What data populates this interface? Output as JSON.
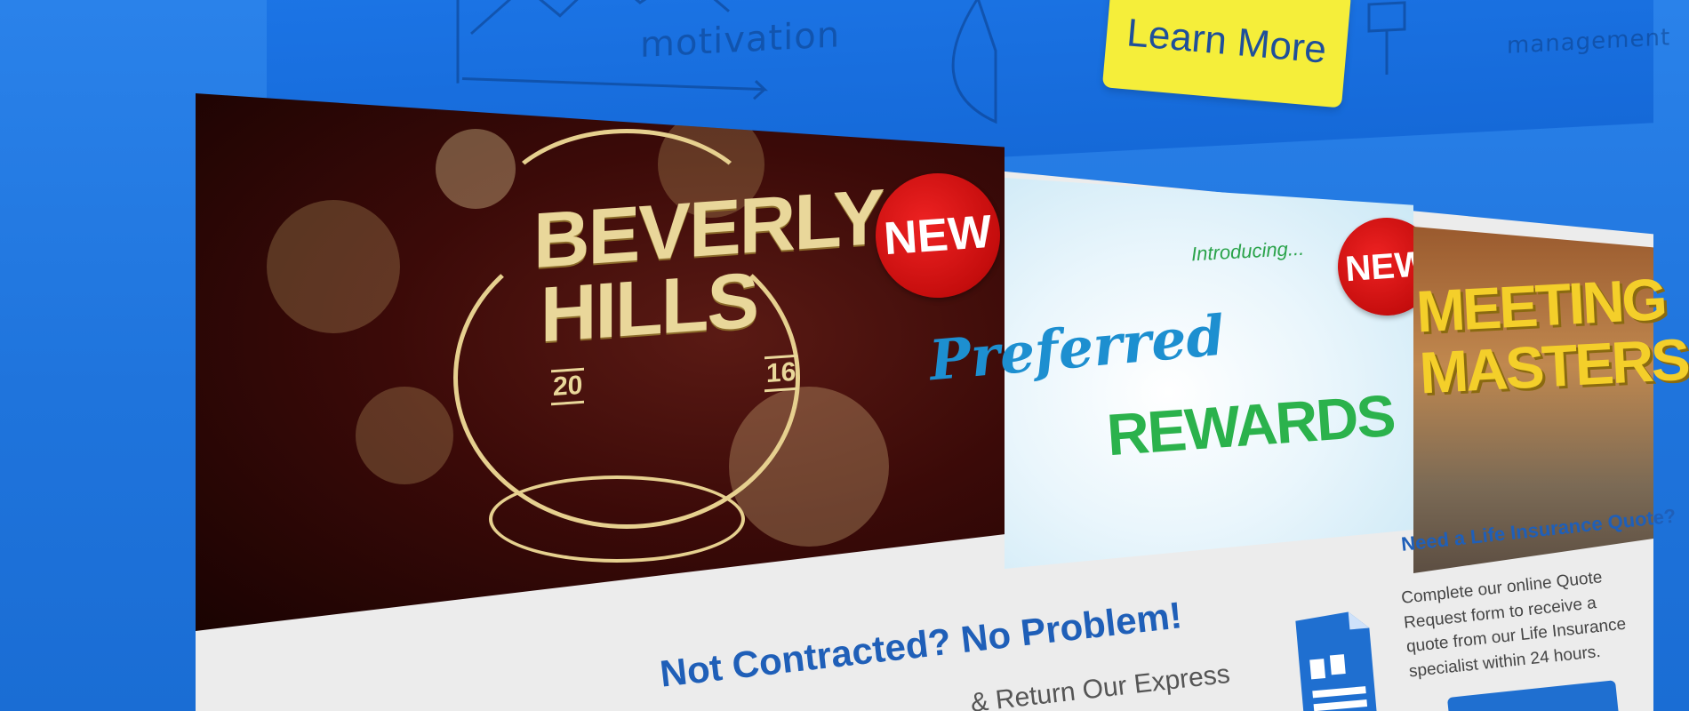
{
  "hero": {
    "learn_more_label": "Learn More",
    "sketch_words": [
      "motivation",
      "management"
    ]
  },
  "banners": {
    "beverly_hills": {
      "title_line1": "BEVERLY",
      "title_line2": "HILLS",
      "year_left": "20",
      "year_right": "16",
      "badge": "NEW"
    },
    "preferred_rewards": {
      "intro": "Introducing...",
      "title_line1": "Preferred",
      "title_line2": "REWARDS",
      "badge": "NEW"
    },
    "meeting_masters": {
      "title_line1": "MEETING",
      "title_line2": "MASTERS"
    }
  },
  "content": {
    "heading": "Not Contracted? No Problem!",
    "body_fragment": "& Return Our Express"
  },
  "quote": {
    "heading": "Need a Life Insurance Quote?",
    "body": "Complete our online Quote Request form to receive a quote from our Life Insurance specialist within 24 hours."
  },
  "colors": {
    "background_blue": "#1f77e0",
    "button_yellow": "#f5ee3a",
    "heading_blue": "#1f5fb8",
    "badge_red": "#cc1010",
    "rewards_green": "#2bb24c",
    "gold": "#e9d79a"
  },
  "icons": {
    "quote": "document-quote-icon"
  }
}
